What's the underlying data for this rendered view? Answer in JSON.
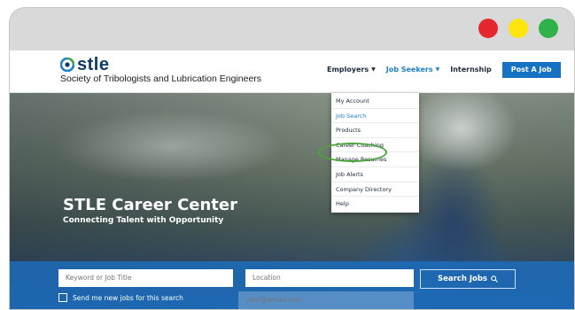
{
  "window": {
    "controls": [
      "red",
      "yellow",
      "green"
    ],
    "colors": {
      "red": "#e5272e",
      "yellow": "#ffe60a",
      "green": "#2fb24a"
    }
  },
  "brand": {
    "logo_text": "stle",
    "tagline": "Society of Tribologists and Lubrication Engineers",
    "color": "#0c3a66"
  },
  "nav": {
    "employers": "Employers",
    "job_seekers": "Job Seekers",
    "internship": "Internship",
    "post_job": "Post A Job",
    "accent": "#1673c3"
  },
  "dropdown": {
    "items": [
      "My Account",
      "Job Search",
      "Products",
      "Career Coaching",
      "Manage Resumes",
      "Job Alerts",
      "Company Directory",
      "Help"
    ],
    "highlight_color": "#4ea33b"
  },
  "hero": {
    "title": "STLE Career Center",
    "subtitle": "Connecting Talent with Opportunity"
  },
  "search": {
    "keyword_placeholder": "Keyword or Job Title",
    "location_placeholder": "Location",
    "button_label": "Search Jobs",
    "checkbox_label": "Send me new jobs for this search",
    "email_placeholder": "your@email.com"
  }
}
